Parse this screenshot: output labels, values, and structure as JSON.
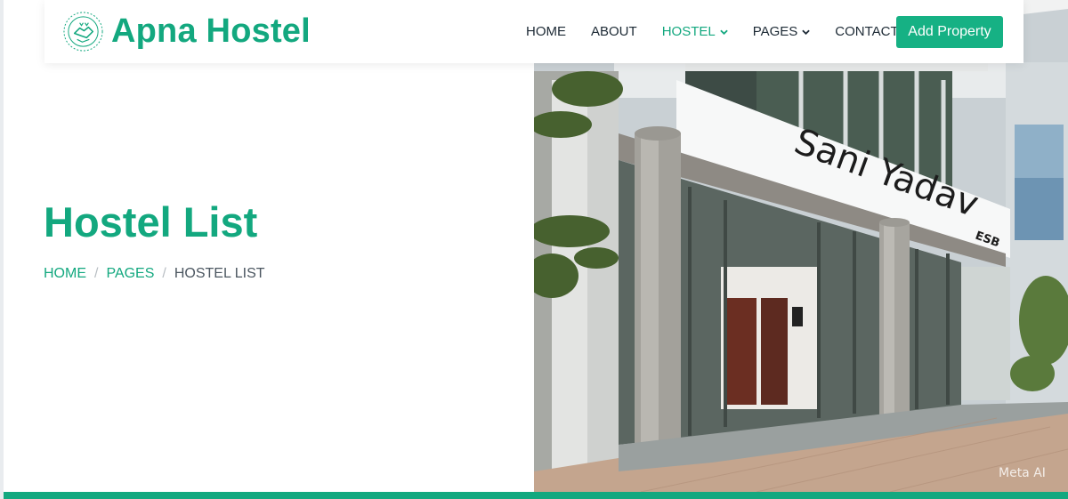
{
  "brand": {
    "name": "Apna Hostel",
    "logo_icon": "handshake-logo-icon"
  },
  "nav": {
    "items": [
      {
        "label": "HOME",
        "active": false,
        "dropdown": false
      },
      {
        "label": "ABOUT",
        "active": false,
        "dropdown": false
      },
      {
        "label": "HOSTEL",
        "active": true,
        "dropdown": true
      },
      {
        "label": "PAGES",
        "active": false,
        "dropdown": true
      },
      {
        "label": "CONTACT",
        "active": false,
        "dropdown": false
      }
    ],
    "cta_label": "Add Property"
  },
  "hero": {
    "title": "Hostel List",
    "breadcrumb": {
      "home": "HOME",
      "pages": "PAGES",
      "current": "HOSTEL LIST",
      "separator": "/"
    },
    "photo": {
      "sign_text": "Sani Yadav",
      "sign_sub": "ESB",
      "watermark": "Meta AI"
    }
  },
  "colors": {
    "accent": "#13a87f",
    "button": "#16b184",
    "text": "#1d2a35"
  }
}
